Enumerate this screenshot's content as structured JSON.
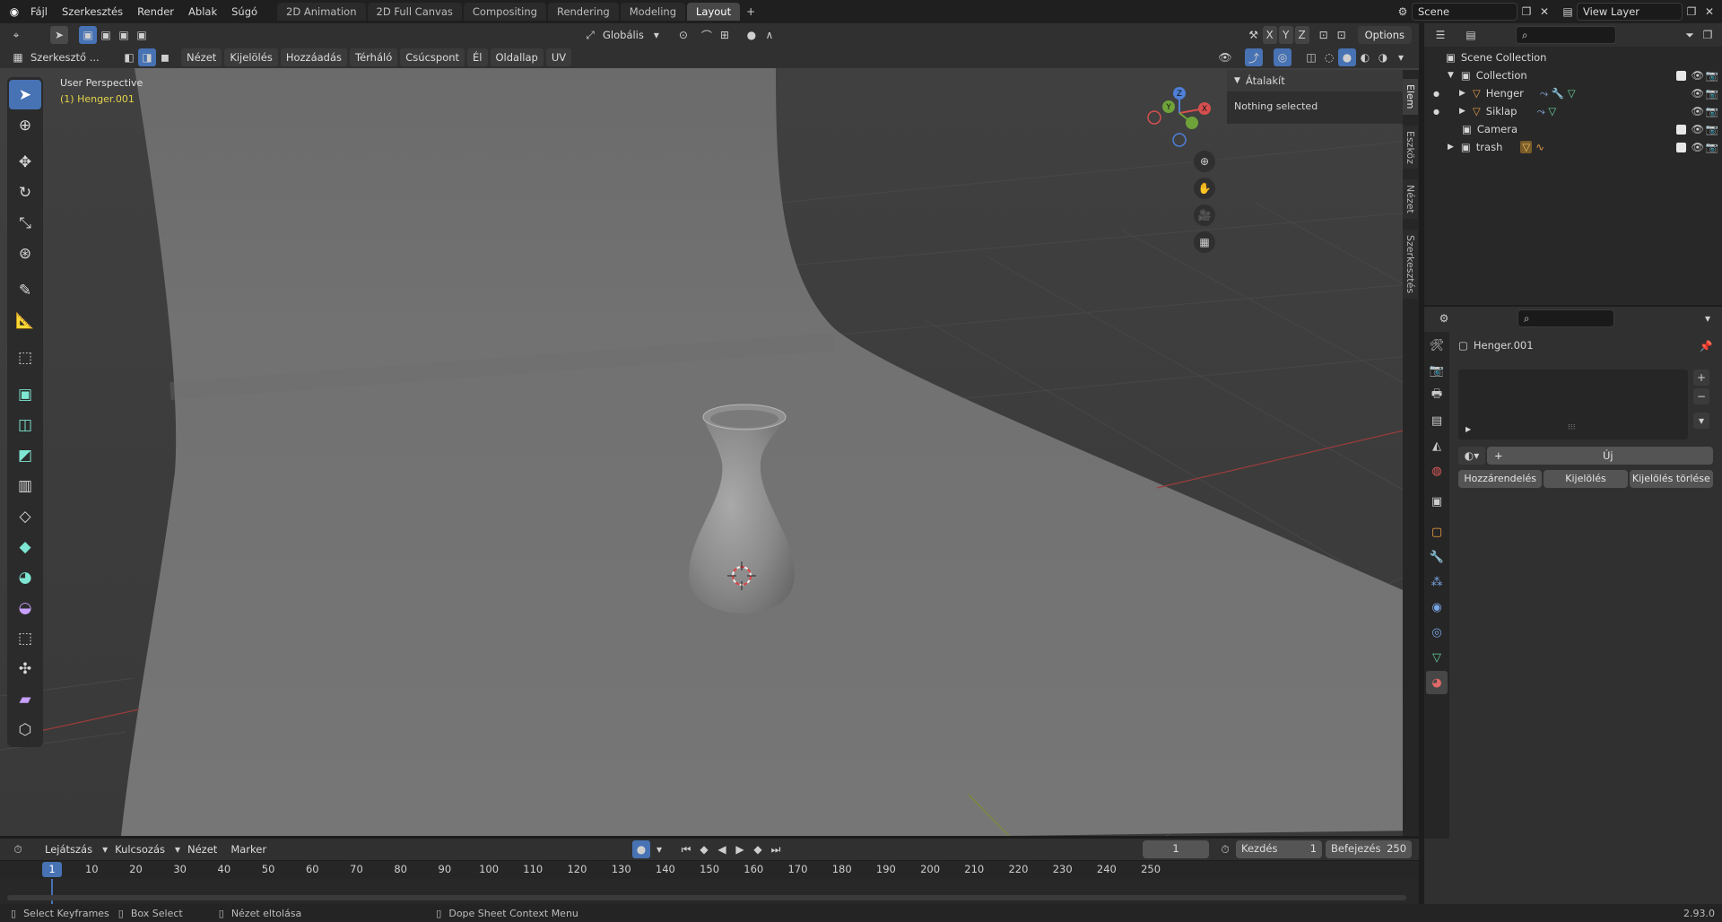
{
  "topbar": {
    "menus": [
      "Fájl",
      "Szerkesztés",
      "Render",
      "Ablak",
      "Súgó"
    ],
    "workspaces": [
      "2D Animation",
      "2D Full Canvas",
      "Compositing",
      "Rendering",
      "Modeling",
      "Layout"
    ],
    "active_workspace": "Layout",
    "scene": "Scene",
    "view_layer": "View Layer"
  },
  "viewport": {
    "mode": "Szerkesztő ...",
    "menus": [
      "Nézet",
      "Kijelölés",
      "Hozzáadás",
      "Térháló",
      "Csúcspont",
      "Él",
      "Oldallap",
      "UV"
    ],
    "orientation": "Globális",
    "options_label": "Options",
    "axes": [
      "X",
      "Y",
      "Z"
    ],
    "view_name": "User Perspective",
    "object_label": "(1) Henger.001",
    "accent_color": "#4772b3",
    "selected_text_color": "#e5d44a"
  },
  "npanel": {
    "header": "Átalakít",
    "message": "Nothing selected",
    "tabs": [
      "Elem",
      "Eszköz",
      "Nézet",
      "Szerkesztés"
    ]
  },
  "outliner": {
    "root": "Scene Collection",
    "items": [
      {
        "label": "Collection",
        "type": "collection"
      },
      {
        "label": "Henger",
        "type": "mesh"
      },
      {
        "label": "Siklap",
        "type": "mesh"
      },
      {
        "label": "Camera",
        "type": "collection"
      },
      {
        "label": "trash",
        "type": "collection"
      }
    ]
  },
  "properties": {
    "object_name": "Henger.001",
    "new_button": "Új",
    "buttons": [
      "Hozzárendelés",
      "Kijelölés",
      "Kijelölés törlése"
    ]
  },
  "timeline": {
    "menus": [
      "Lejátszás",
      "Kulcsozás",
      "Nézet",
      "Marker"
    ],
    "current_frame": "1",
    "start_label": "Kezdés",
    "start_value": "1",
    "end_label": "Befejezés",
    "end_value": "250",
    "ruler": [
      "1",
      "10",
      "20",
      "30",
      "40",
      "50",
      "60",
      "70",
      "80",
      "90",
      "100",
      "110",
      "120",
      "130",
      "140",
      "150",
      "160",
      "170",
      "180",
      "190",
      "200",
      "210",
      "220",
      "230",
      "240",
      "250"
    ]
  },
  "statusbar": {
    "items": [
      "Select Keyframes",
      "Box Select",
      "Nézet eltolása",
      "Dope Sheet Context Menu"
    ],
    "version": "2.93.0"
  }
}
